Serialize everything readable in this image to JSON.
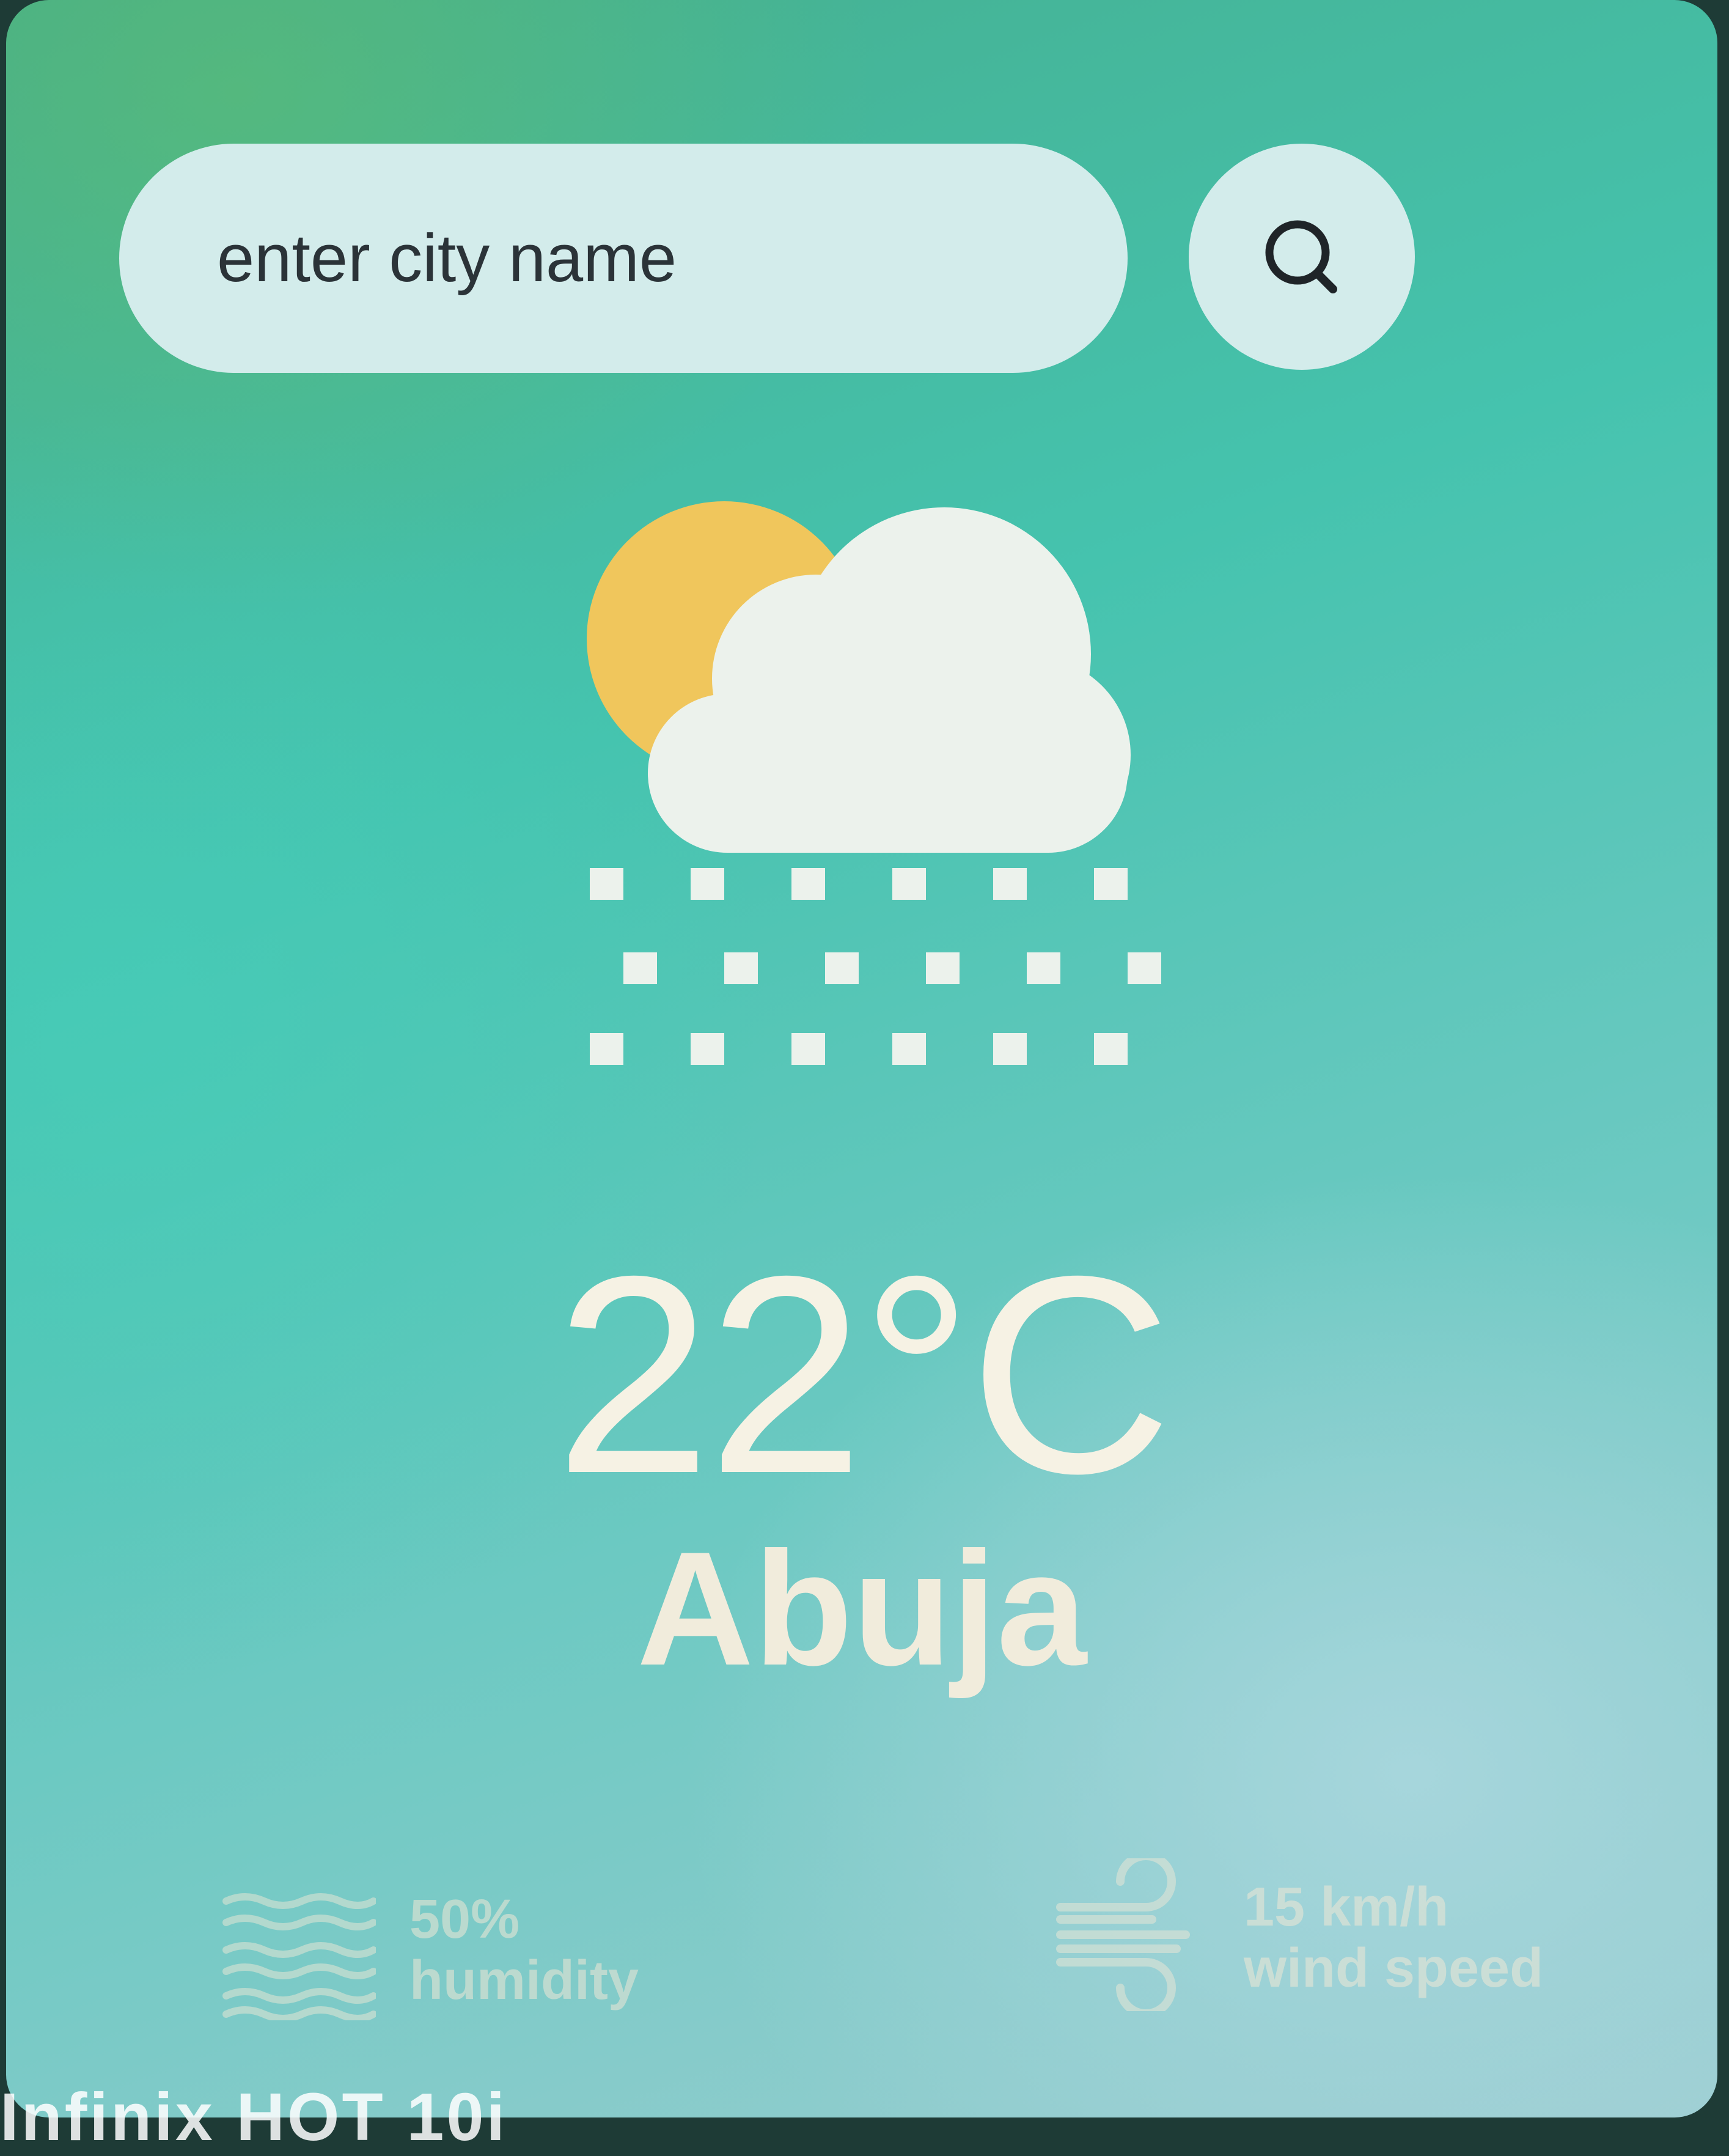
{
  "search": {
    "placeholder": "enter city name",
    "button_icon": "search-icon"
  },
  "weather": {
    "icon": "partly-cloudy-snow-icon",
    "temperature": "22°C",
    "city": "Abuja"
  },
  "stats": {
    "humidity": {
      "icon": "humidity-waves-icon",
      "value": "50%",
      "label": "humidity"
    },
    "wind": {
      "icon": "wind-icon",
      "value": "15 km/h",
      "label": "wind speed"
    }
  },
  "colors": {
    "gradient_top": "#45ad8c",
    "gradient_bottom": "#9ccdd1",
    "pill": "#d3eceb",
    "sun": "#f0c65c",
    "cloud": "#ecf2ec",
    "text": "#f6f2e4"
  },
  "watermark": "Infinix HOT 10i"
}
